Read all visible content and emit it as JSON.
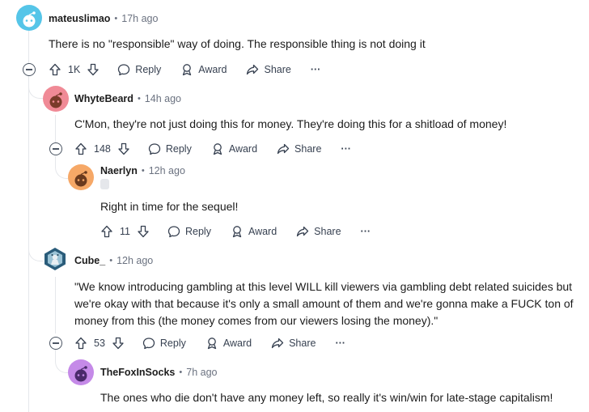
{
  "comments": [
    {
      "author": "mateuslimao",
      "time": "17h ago",
      "body": [
        "There is no \"responsible\" way of doing. The responsible thing is not doing it"
      ],
      "votes": "1K",
      "avatar_color": "#55c5e8"
    },
    {
      "author": "WhyteBeard",
      "time": "14h ago",
      "body": [
        "C'Mon, they're not just doing this for money. They're doing this for a shitload of money!"
      ],
      "votes": "148",
      "avatar_color": "#f08a96"
    },
    {
      "author": "Naerlyn",
      "time": "12h ago",
      "body": [
        "Right in time for the sequel!"
      ],
      "votes": "11",
      "avatar_color": "#f6a867"
    },
    {
      "author": "Cube_",
      "time": "12h ago",
      "body": [
        "\"We know introducing gambling at this level WILL kill viewers via gambling debt related suicides but",
        "we're okay with that because it's only a small amount of them and we're gonna make a FUCK ton of",
        "money from this (the money comes from our viewers losing the money).\""
      ],
      "votes": "53",
      "avatar_color": "#2a5c7a"
    },
    {
      "author": "TheFoxInSocks",
      "time": "7h ago",
      "body": [
        "The ones who die don't have any money left, so really it's win/win for late-stage capitalism!"
      ],
      "avatar_color": "#c58ae8"
    }
  ],
  "actions": {
    "reply": "Reply",
    "award": "Award",
    "share": "Share",
    "more": "···"
  }
}
